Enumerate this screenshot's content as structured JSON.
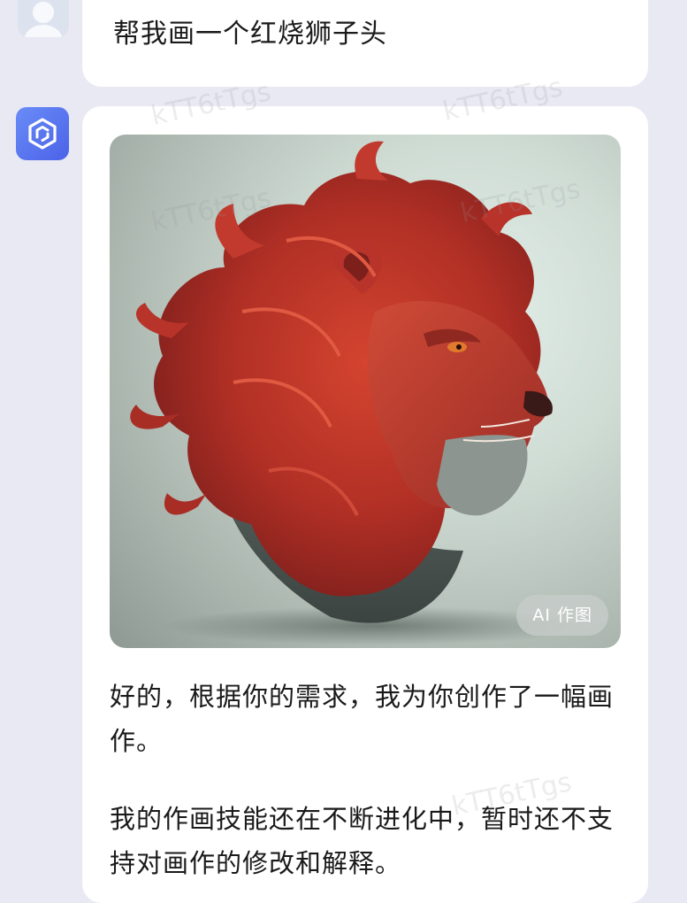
{
  "user_message": {
    "text": "帮我画一个红烧狮子头"
  },
  "bot_message": {
    "image": {
      "subject": "red lion head illustration",
      "badge": "AI 作图"
    },
    "reply_paragraph_1": "好的，根据你的需求，我为你创作了一幅画作。",
    "reply_paragraph_2": "我的作画技能还在不断进化中，暂时还不支持对画作的修改和解释。"
  },
  "watermark": "kTT6tTgs",
  "colors": {
    "page_background": "#e9e9f3",
    "bubble_background": "#ffffff",
    "bot_avatar": "#5a74ef",
    "lion_red": "#c0392b"
  },
  "icons": {
    "user_avatar": "user-avatar-icon",
    "bot_avatar": "hexagon-logo-icon"
  }
}
